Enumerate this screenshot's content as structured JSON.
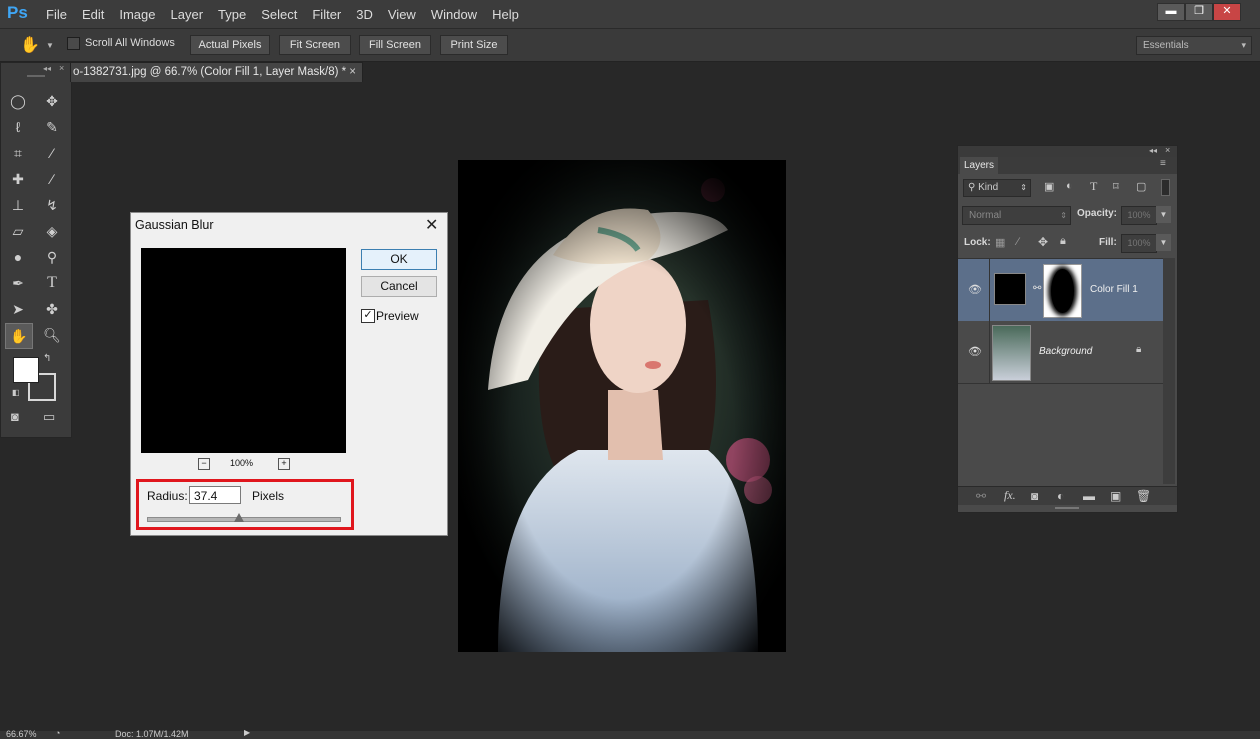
{
  "app": {
    "logo": "Ps"
  },
  "menu": [
    "File",
    "Edit",
    "Image",
    "Layer",
    "Type",
    "Select",
    "Filter",
    "3D",
    "View",
    "Window",
    "Help"
  ],
  "window_controls": {
    "minimize": "▬",
    "restore": "❐",
    "close": "✕"
  },
  "options_bar": {
    "scroll_all_windows": "Scroll All Windows",
    "actual_pixels": "Actual Pixels",
    "fit_screen": "Fit Screen",
    "fill_screen": "Fill Screen",
    "print_size": "Print Size",
    "workspace": "Essentials"
  },
  "document_tab": {
    "title": "o-1382731.jpg @ 66.7% (Color Fill 1, Layer Mask/8) *",
    "close": "×"
  },
  "dialog": {
    "title": "Gaussian Blur",
    "ok": "OK",
    "cancel": "Cancel",
    "preview_label": "Preview",
    "preview_checked": true,
    "zoom": "100%",
    "radius_label": "Radius:",
    "radius_value": "37.4",
    "units": "Pixels",
    "slider_position": 0.48,
    "highlight_color": "#e0161d"
  },
  "layers_panel": {
    "tab": "Layers",
    "filter_kind": "Kind",
    "blend_mode": "Normal",
    "opacity_label": "Opacity:",
    "opacity_value": "100%",
    "lock_label": "Lock:",
    "fill_label": "Fill:",
    "fill_value": "100%",
    "layers": [
      {
        "name": "Color Fill 1",
        "selected": true
      },
      {
        "name": "Background",
        "italic": true,
        "locked": true
      }
    ],
    "footer_icons": [
      "link-icon",
      "fx-icon",
      "mask-icon",
      "adjustment-icon",
      "folder-icon",
      "new-layer-icon",
      "trash-icon"
    ],
    "fx_label": "fx."
  },
  "status": {
    "zoom": "66.67%",
    "doc": "Doc: 1.07M/1.42M"
  },
  "colors": {
    "accent": "#3fa6f5",
    "selected_layer": "#5c6f8a"
  }
}
